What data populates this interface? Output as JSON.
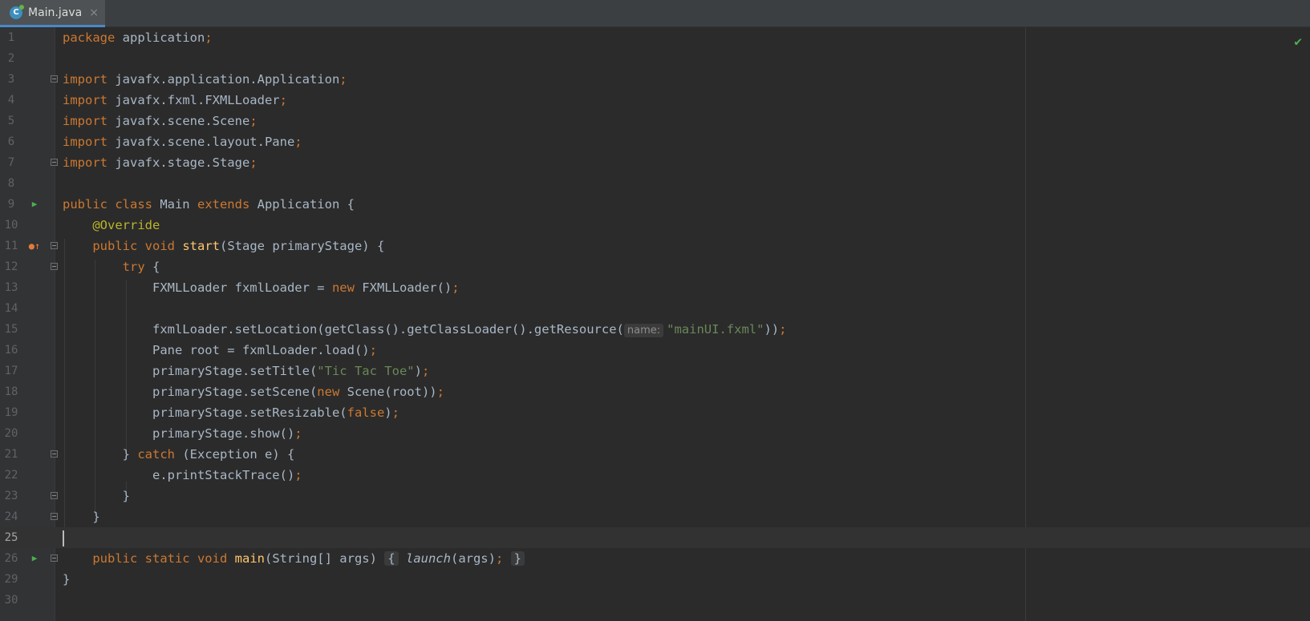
{
  "tab": {
    "filename": "Main.java",
    "icon": "java-class-icon",
    "close_glyph": "×",
    "icon_letter": "C"
  },
  "status": {
    "check_glyph": "✔"
  },
  "lines": [
    {
      "n": "1"
    },
    {
      "n": "2"
    },
    {
      "n": "3"
    },
    {
      "n": "4"
    },
    {
      "n": "5"
    },
    {
      "n": "6"
    },
    {
      "n": "7"
    },
    {
      "n": "8"
    },
    {
      "n": "9"
    },
    {
      "n": "10"
    },
    {
      "n": "11"
    },
    {
      "n": "12"
    },
    {
      "n": "13"
    },
    {
      "n": "14"
    },
    {
      "n": "15"
    },
    {
      "n": "16"
    },
    {
      "n": "17"
    },
    {
      "n": "18"
    },
    {
      "n": "19"
    },
    {
      "n": "20"
    },
    {
      "n": "21"
    },
    {
      "n": "22"
    },
    {
      "n": "23"
    },
    {
      "n": "24"
    },
    {
      "n": "25"
    },
    {
      "n": "26"
    },
    {
      "n": "29"
    },
    {
      "n": "30"
    }
  ],
  "code": {
    "l1_kw": "package",
    "l1_rest": " application",
    "semi": ";",
    "import": "import",
    "l3": " javafx.application.Application",
    "l4": " javafx.fxml.FXMLLoader",
    "l5": " javafx.scene.Scene",
    "l6": " javafx.scene.layout.Pane",
    "l7": " javafx.stage.Stage",
    "l9_kw1": "public class",
    "l9_name": " Main ",
    "l9_kw2": "extends",
    "l9_rest": " Application {",
    "l10": "@Override",
    "l11_kw": "public void",
    "l11_fn": "start",
    "l11_rest": "(Stage primaryStage) {",
    "l12_kw": "try",
    "l12_rest": " {",
    "l13_a": "FXMLLoader fxmlLoader = ",
    "new": "new",
    "l13_b": " FXMLLoader()",
    "l15_a": "fxmlLoader.setLocation(getClass().getClassLoader().getResource(",
    "l15_hint": "name:",
    "l15_str": "\"mainUI.fxml\"",
    "l15_b": "))",
    "l16": "Pane root = fxmlLoader.load()",
    "l17_a": "primaryStage.setTitle(",
    "l17_str": "\"Tic Tac Toe\"",
    "l17_b": ")",
    "l18_a": "primaryStage.setScene(",
    "l18_b": " Scene(root))",
    "l19_a": "primaryStage.setResizable(",
    "l19_kw": "false",
    "l19_b": ")",
    "l20": "primaryStage.show()",
    "l21_a": "} ",
    "l21_kw": "catch",
    "l21_b": " (Exception e) {",
    "l22": "e.printStackTrace()",
    "close": "}",
    "l26_kw": "public static void",
    "l26_fn": "main",
    "l26_rest": "(String[] args) ",
    "l26_open": "{",
    "l26_call": "launch",
    "l26_args": "(args)",
    "l26_close": "}"
  }
}
